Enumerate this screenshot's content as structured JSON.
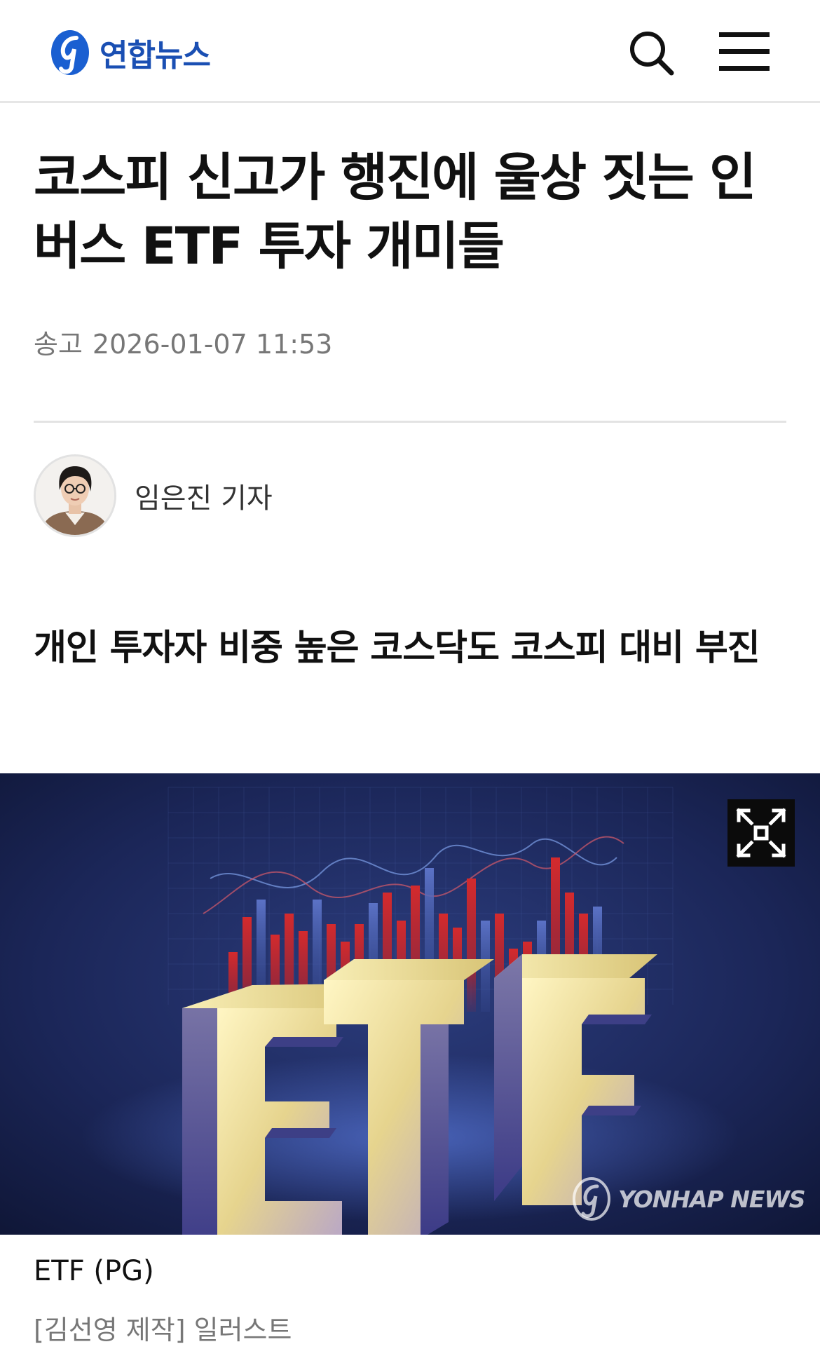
{
  "header": {
    "logo_text": "연합뉴스",
    "search_icon": "search-icon",
    "menu_icon": "hamburger-menu-icon"
  },
  "article": {
    "headline_line1": "코스피 신고가 행진에 울상 짓는 인",
    "headline_line2": "버스 ETF 투자 개미들",
    "send_label": "송고",
    "send_datetime": "2026-01-07 11:53",
    "reporter": "임은진 기자",
    "subtitle": "개인 투자자 비중 높은 코스닥도 코스피 대비 부진"
  },
  "photo": {
    "image_text": "ETF",
    "watermark": "YONHAP NEWS",
    "expand_icon": "expand-icon",
    "caption_title": "ETF (PG)",
    "caption_credit": "[김선영 제작] 일러스트"
  },
  "colors": {
    "brand_blue": "#1a4fb3",
    "photo_bg": "#1c2858",
    "bar_red": "#c8262c",
    "letter_gold": "#e9dc93"
  }
}
